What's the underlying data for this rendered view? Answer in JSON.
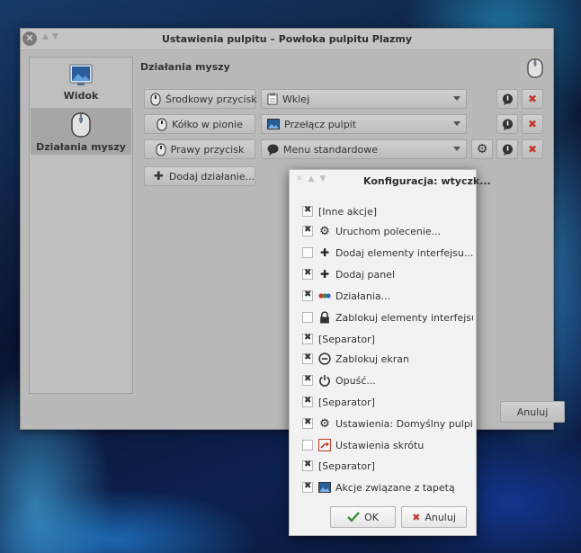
{
  "main_window": {
    "title": "Ustawienia pulpitu – Powłoka pulpitu Plazmy",
    "close_glyph": "✕",
    "sidebar": [
      {
        "label": "Widok",
        "icon": "wallpaper-icon"
      },
      {
        "label": "Działania myszy",
        "icon": "mouse-icon"
      }
    ],
    "section_title": "Działania myszy",
    "actions": [
      {
        "trigger": "Środkowy przycisk",
        "plugin": "Wklej",
        "plugin_icon": "clipboard-icon",
        "has_config": false
      },
      {
        "trigger": "Kółko w pionie",
        "plugin": "Przełącz pulpit",
        "plugin_icon": "desktop-icon",
        "has_config": false
      },
      {
        "trigger": "Prawy przycisk",
        "plugin": "Menu standardowe",
        "plugin_icon": "menu-bubble-icon",
        "has_config": true
      }
    ],
    "add_action": "Dodaj działanie...",
    "cancel": "Anuluj"
  },
  "popup": {
    "title": "Konfiguracja: wtyczk...",
    "items": [
      {
        "label": "[Inne akcje]",
        "checked": true,
        "icon": ""
      },
      {
        "label": "Uruchom polecenie...",
        "checked": true,
        "icon": "gear-icon"
      },
      {
        "label": "Dodaj elementy interfejsu...",
        "checked": false,
        "icon": "plus-icon"
      },
      {
        "label": "Dodaj panel",
        "checked": true,
        "icon": "plus-icon"
      },
      {
        "label": "Działania...",
        "checked": true,
        "icon": "activities-icon"
      },
      {
        "label": "Zablokuj elementy interfejsu",
        "checked": false,
        "icon": "lock-icon"
      },
      {
        "label": "[Separator]",
        "checked": true,
        "icon": ""
      },
      {
        "label": "Zablokuj ekran",
        "checked": true,
        "icon": "lock-screen-icon"
      },
      {
        "label": "Opuść...",
        "checked": true,
        "icon": "power-icon"
      },
      {
        "label": "[Separator]",
        "checked": true,
        "icon": ""
      },
      {
        "label": "Ustawienia: Domyślny pulpit",
        "checked": true,
        "icon": "gear-icon"
      },
      {
        "label": "Ustawienia skrótu",
        "checked": false,
        "icon": "shortcut-icon"
      },
      {
        "label": "[Separator]",
        "checked": true,
        "icon": ""
      },
      {
        "label": "Akcje związane z tapetą",
        "checked": true,
        "icon": "wallpaper-icon"
      }
    ],
    "ok": "OK",
    "cancel": "Anuluj"
  },
  "colors": {
    "window_bg": "#b9b9b9",
    "popup_bg": "#f2f2f2",
    "remove_red": "#c0392b"
  }
}
